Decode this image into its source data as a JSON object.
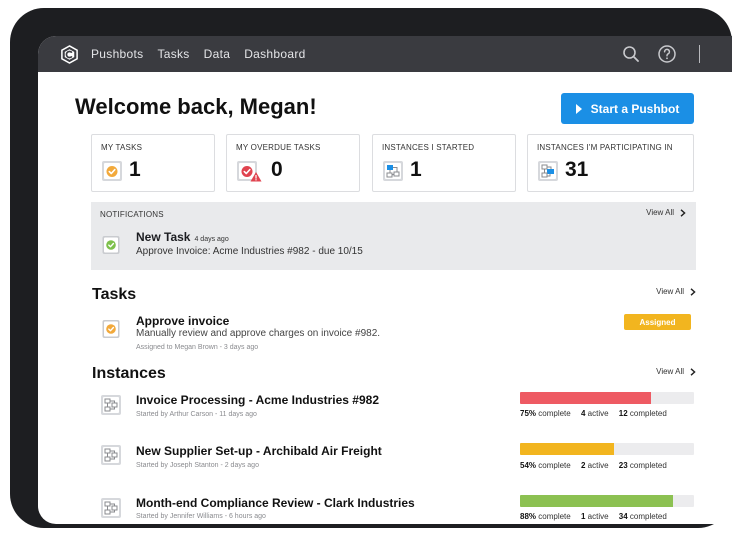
{
  "nav": {
    "items": [
      "Pushbots",
      "Tasks",
      "Data",
      "Dashboard"
    ],
    "icons": [
      "search-icon",
      "help-icon"
    ]
  },
  "welcome": "Welcome back, Megan!",
  "start_button": "Start a Pushbot",
  "stats": [
    {
      "label": "MY TASKS",
      "value": "1",
      "icon": "task-check-icon"
    },
    {
      "label": "MY OVERDUE TASKS",
      "value": "0",
      "icon": "overdue-task-icon"
    },
    {
      "label": "INSTANCES I STARTED",
      "value": "1",
      "icon": "instance-started-icon"
    },
    {
      "label": "INSTANCES I'M PARTICIPATING IN",
      "value": "31",
      "icon": "instance-participating-icon"
    }
  ],
  "notifications": {
    "header": "NOTIFICATIONS",
    "view_all": "View All",
    "items": [
      {
        "title": "New Task",
        "time": "4 days ago",
        "desc": "Approve Invoice: Acme Industries #982 - due 10/15"
      }
    ]
  },
  "tasks": {
    "title": "Tasks",
    "view_all": "View All",
    "items": [
      {
        "title": "Approve invoice",
        "desc": "Manually review and approve charges on invoice #982.",
        "meta": "Assigned to Megan Brown - 3 days ago",
        "badge": "Assigned"
      }
    ]
  },
  "instances": {
    "title": "Instances",
    "view_all": "View All",
    "items": [
      {
        "title": "Invoice Processing - Acme Industries #982",
        "meta": "Started by Arthur Carson - 11 days ago",
        "percent": 75,
        "percent_text": "75%",
        "complete_label": "complete",
        "active": "4",
        "active_label": "active",
        "completed": "12",
        "completed_label": "completed",
        "color": "#ee5a63"
      },
      {
        "title": "New Supplier Set-up - Archibald Air Freight",
        "meta": "Started by Joseph Stanton - 2 days ago",
        "percent": 54,
        "percent_text": "54%",
        "complete_label": "complete",
        "active": "2",
        "active_label": "active",
        "completed": "23",
        "completed_label": "completed",
        "color": "#f2b51f"
      },
      {
        "title": "Month-end Compliance Review - Clark Industries",
        "meta": "Started by Jennifer Williams - 6 hours ago",
        "percent": 88,
        "percent_text": "88%",
        "complete_label": "complete",
        "active": "1",
        "active_label": "active",
        "completed": "34",
        "completed_label": "completed",
        "color": "#8cc152"
      }
    ]
  },
  "colors": {
    "accent": "#1b8fe5",
    "topbar": "#3a3b40",
    "badge": "#f2b51f"
  }
}
